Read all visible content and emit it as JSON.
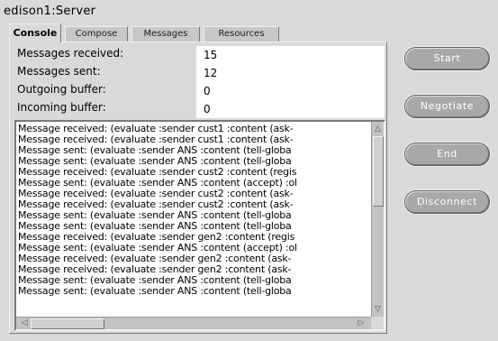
{
  "window": {
    "title": "edison1:Server"
  },
  "tabs": [
    {
      "label": "Console",
      "active": true
    },
    {
      "label": "Compose",
      "active": false
    },
    {
      "label": "Messages",
      "active": false
    },
    {
      "label": "Resources",
      "active": false
    }
  ],
  "stats": [
    {
      "label": "Messages received:",
      "value": "15"
    },
    {
      "label": "Messages sent:",
      "value": "12"
    },
    {
      "label": "Outgoing buffer:",
      "value": "0"
    },
    {
      "label": "Incoming buffer:",
      "value": "0"
    }
  ],
  "log": {
    "lines": [
      "Message received: (evaluate :sender cust1 :content (ask-",
      "Message received: (evaluate :sender cust1 :content (ask-",
      "Message sent: (evaluate :sender ANS :content (tell-globa",
      "Message sent: (evaluate :sender ANS :content (tell-globa",
      "Message received: (evaluate :sender cust2 :content (regis",
      "Message sent: (evaluate :sender ANS :content (accept) :ol",
      "Message received: (evaluate :sender cust2 :content (ask-",
      "Message received: (evaluate :sender cust2 :content (ask-",
      "Message sent: (evaluate :sender ANS :content (tell-globa",
      "Message sent: (evaluate :sender ANS :content (tell-globa",
      "Message received: (evaluate :sender gen2 :content (regis",
      "Message sent: (evaluate :sender ANS :content (accept) :ol",
      "Message received: (evaluate :sender gen2 :content (ask-",
      "Message received: (evaluate :sender gen2 :content (ask-",
      "Message sent: (evaluate :sender ANS :content (tell-globa",
      "Message sent: (evaluate :sender ANS :content (tell-globa"
    ]
  },
  "buttons": {
    "start": "Start",
    "negotiate": "Negotiate",
    "end": "End",
    "disconnect": "Disconnect"
  }
}
